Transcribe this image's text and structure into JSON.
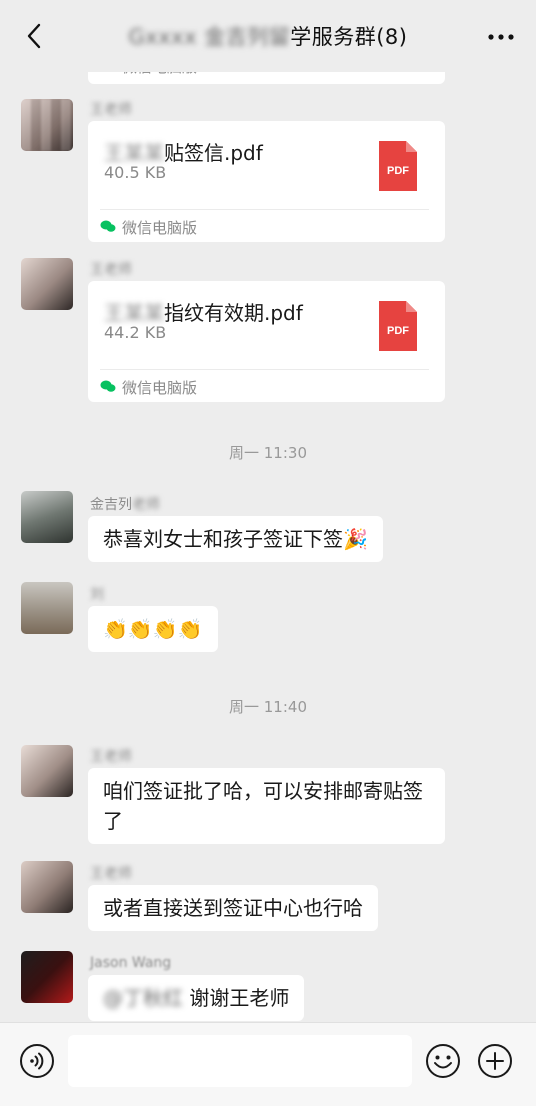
{
  "header": {
    "title_visible": "学服务群(8)",
    "back_icon": "chevron-left-icon",
    "more_icon": "more-dots-icon"
  },
  "messages": {
    "partial_top_source": "微信电脑版",
    "file1": {
      "name_visible": "贴签信.pdf",
      "size": "40.5 KB",
      "source": "微信电脑版",
      "badge": "PDF"
    },
    "file2": {
      "name_visible": "指纹有效期.pdf",
      "size": "44.2 KB",
      "source": "微信电脑版",
      "badge": "PDF"
    },
    "time1": "周一 11:30",
    "msg3": {
      "sender": "金吉列",
      "text": "恭喜刘女士和孩子签证下签🎉"
    },
    "msg4": {
      "sender": "刘",
      "text": "👏👏👏👏"
    },
    "time2": "周一 11:40",
    "msg5": {
      "text": "咱们签证批了哈，可以安排邮寄贴签了"
    },
    "msg6": {
      "text": "或者直接送到签证中心也行哈"
    },
    "msg7": {
      "sender": "Jason Wang",
      "text": "谢谢王老师"
    }
  },
  "bottom": {
    "voice_icon": "voice-icon",
    "emoji_icon": "emoji-icon",
    "plus_icon": "plus-icon"
  },
  "colors": {
    "background": "#ededed",
    "pdf_red": "#e64340",
    "bubble": "#ffffff",
    "bottombar": "#f7f7f7"
  }
}
